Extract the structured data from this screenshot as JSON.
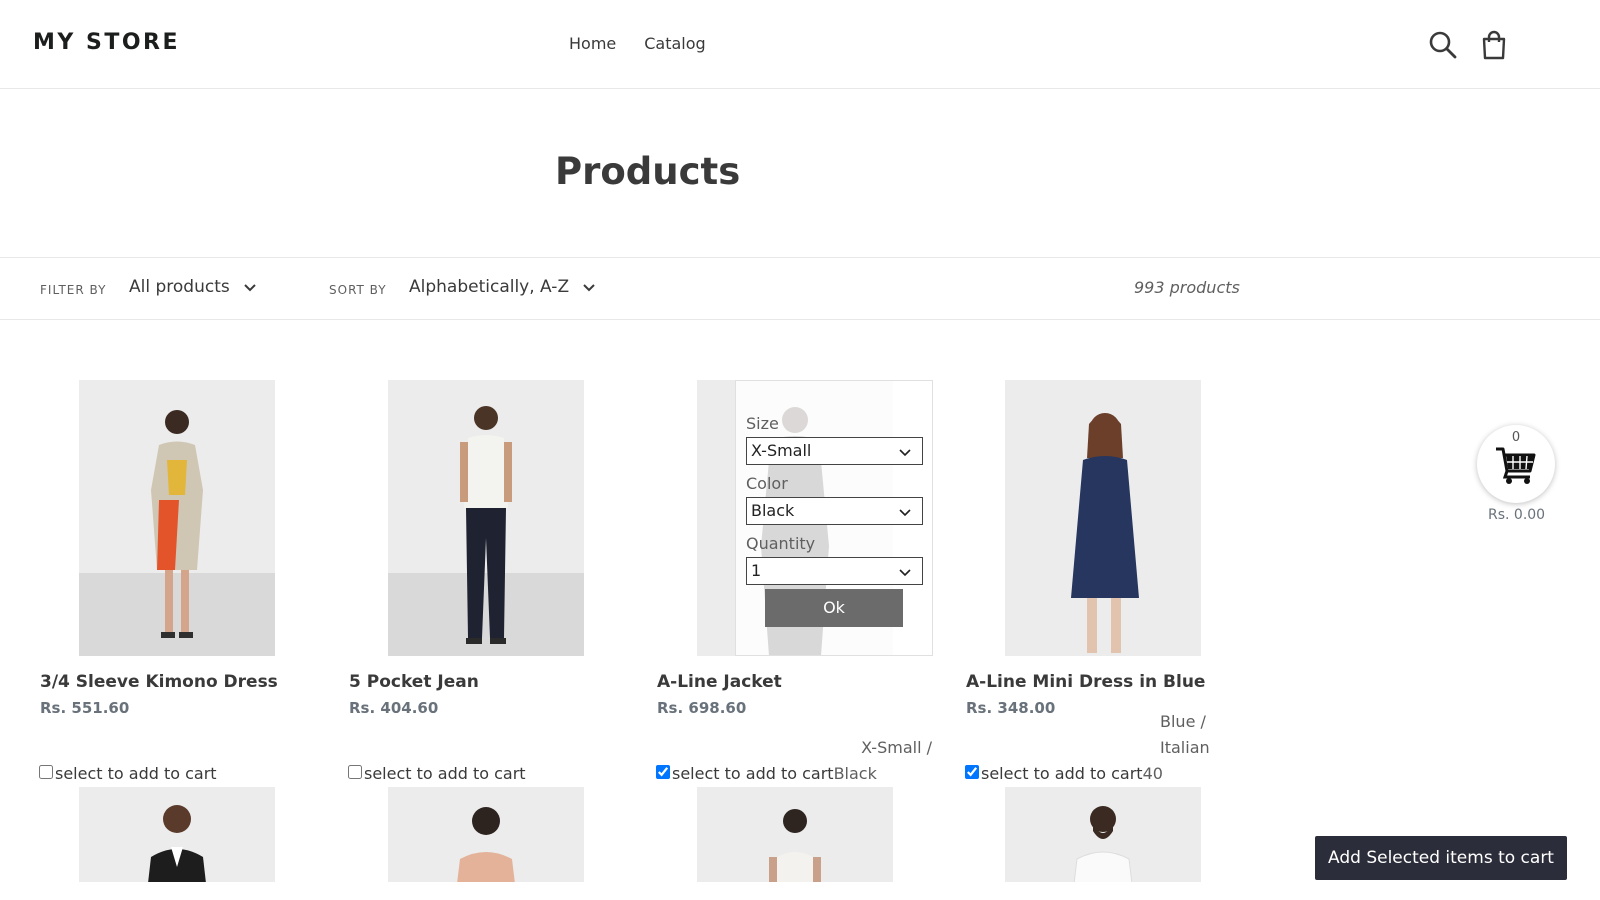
{
  "header": {
    "logo": "MY STORE",
    "nav": [
      "Home",
      "Catalog"
    ],
    "icons": [
      "search-icon",
      "cart-bag-icon"
    ]
  },
  "page": {
    "title": "Products"
  },
  "filters": {
    "filter_label": "FILTER BY",
    "filter_value": "All products",
    "sort_label": "SORT BY",
    "sort_value": "Alphabetically, A-Z",
    "count": "993 products"
  },
  "products": [
    {
      "title": "3/4 Sleeve Kimono Dress",
      "price": "Rs. 551.60",
      "select_label": "select to add to cart",
      "checked": false,
      "variant": ""
    },
    {
      "title": "5 Pocket Jean",
      "price": "Rs. 404.60",
      "select_label": "select to add to cart",
      "checked": false,
      "variant": ""
    },
    {
      "title": "A-Line Jacket",
      "price": "Rs. 698.60",
      "select_label": "select to add to cart",
      "checked": true,
      "variant_line1": "X-Small /",
      "variant_line2": "Black"
    },
    {
      "title": "A-Line Mini Dress in Blue",
      "price": "Rs. 348.00",
      "select_label": "select to add to cart",
      "checked": true,
      "variant_line1": "Blue /",
      "variant_line2": "Italian",
      "variant_line3": "40"
    }
  ],
  "popup": {
    "size_label": "Size",
    "size_value": "X-Small",
    "color_label": "Color",
    "color_value": "Black",
    "quantity_label": "Quantity",
    "quantity_value": "1",
    "ok_label": "Ok"
  },
  "cart_widget": {
    "count": "0",
    "total": "Rs. 0.00"
  },
  "add_selected_label": "Add Selected items to cart"
}
